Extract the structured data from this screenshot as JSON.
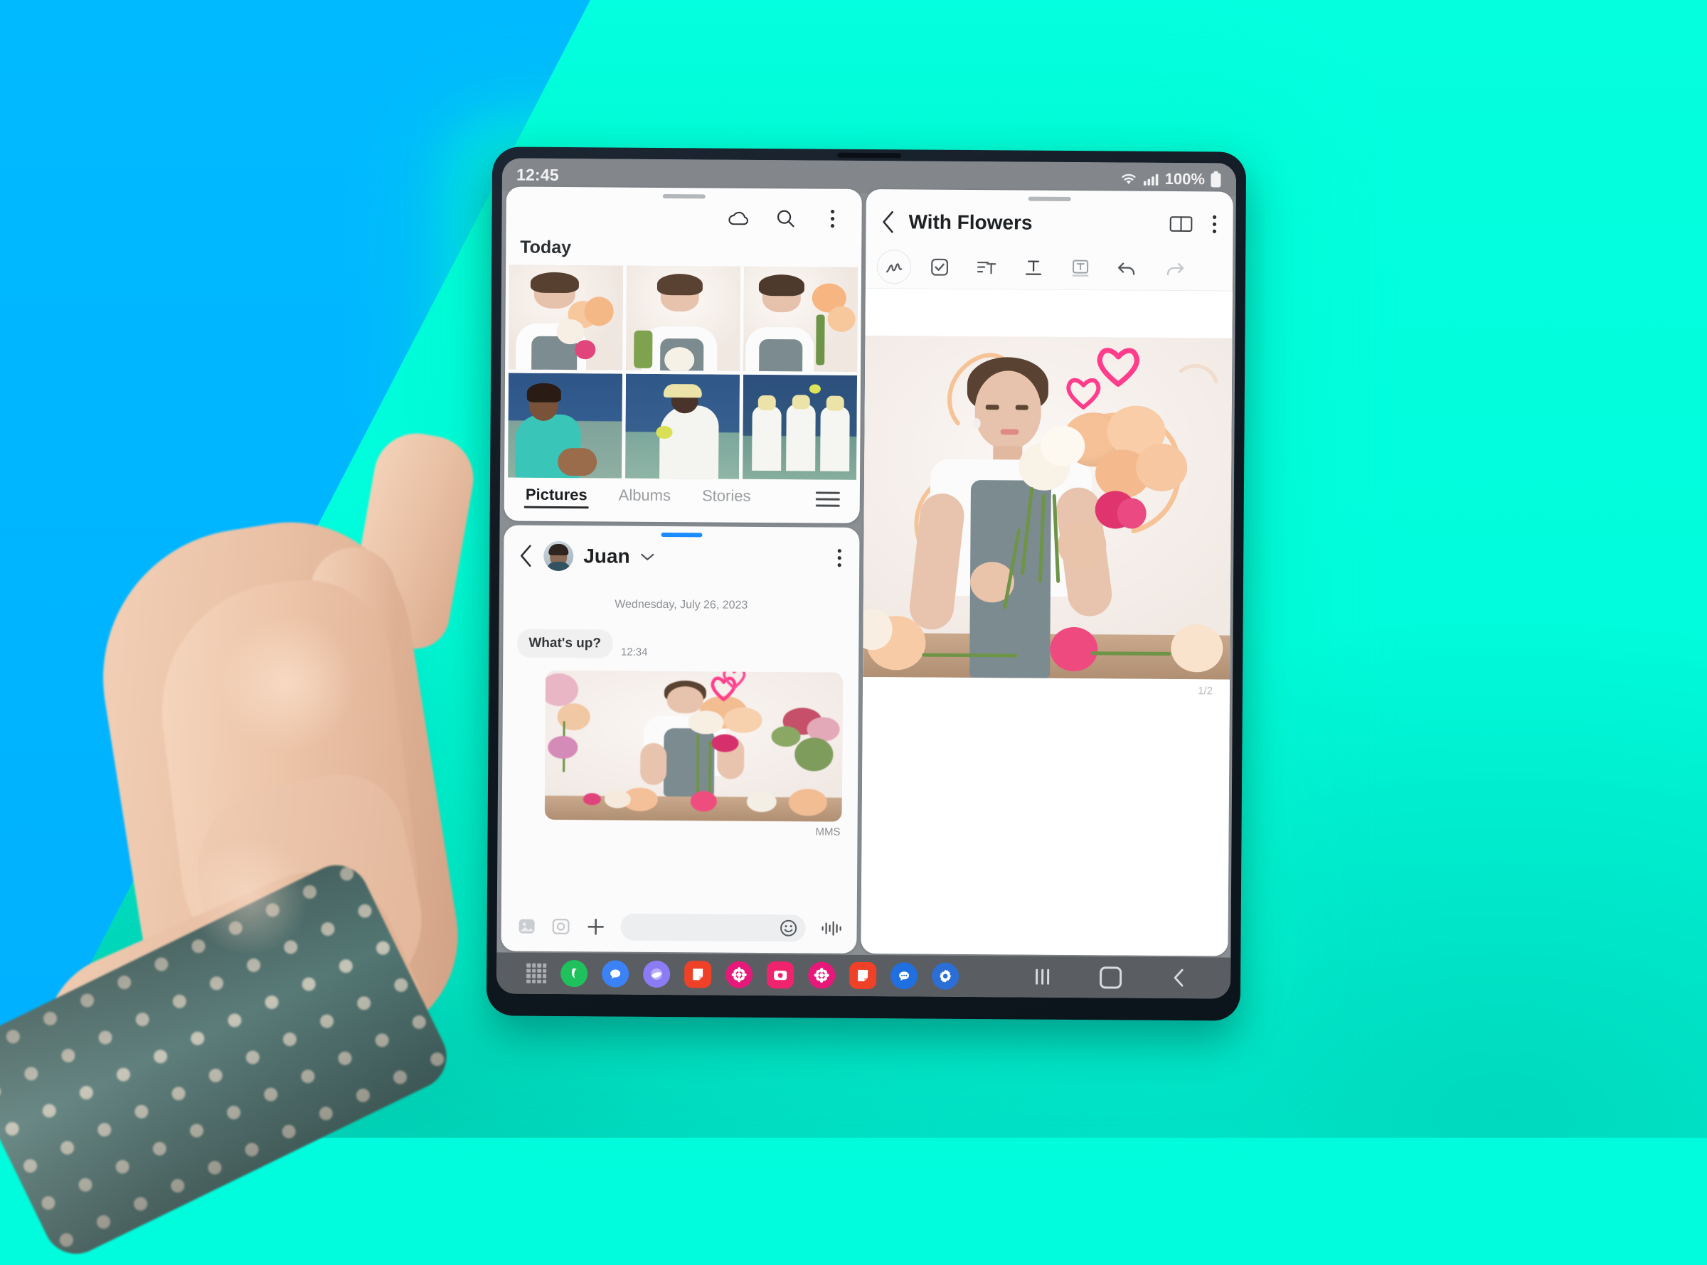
{
  "background": {
    "blue": "#00b4ff",
    "teal": "#00fcdc",
    "teal_shadow": "#00c9ae"
  },
  "device": {
    "name": "foldable-phone",
    "frame_color": "#101820"
  },
  "status_bar": {
    "clock": "12:45",
    "wifi_icon": "wifi-icon",
    "signal_icon": "cellular-signal-icon",
    "battery_percent": "100%",
    "battery_icon": "battery-full-icon"
  },
  "gallery": {
    "window_name": "gallery-app",
    "grabber": "window-handle",
    "actions": [
      {
        "name": "cloud-sync-icon",
        "label": "Cloud"
      },
      {
        "name": "search-icon",
        "label": "Search"
      },
      {
        "name": "more-options-icon",
        "label": "More options"
      }
    ],
    "section_title": "Today",
    "thumbnails": [
      {
        "alt": "florist-smelling-peach-roses",
        "kind": "florist"
      },
      {
        "alt": "florist-looking-down-white-rose",
        "kind": "florist2"
      },
      {
        "alt": "florist-holding-peach-bouquet",
        "kind": "florist3"
      },
      {
        "alt": "tennis-player-resting-teal-towel",
        "kind": "tennis1"
      },
      {
        "alt": "tennis-player-in-white-cap",
        "kind": "tennis2"
      },
      {
        "alt": "three-tennis-players-serving",
        "kind": "tennis3"
      }
    ],
    "tabs": [
      {
        "label": "Pictures",
        "active": true
      },
      {
        "label": "Albums",
        "active": false
      },
      {
        "label": "Stories",
        "active": false
      }
    ],
    "menu_icon": "hamburger-menu-icon"
  },
  "messages": {
    "window_name": "messages-app",
    "back_icon": "back-chevron-icon",
    "avatar": "contact-avatar",
    "contact_name": "Juan",
    "dropdown_icon": "chevron-down-icon",
    "more_icon": "more-options-icon",
    "date_divider": "Wednesday, July 26, 2023",
    "bubbles": [
      {
        "text": "What's up?",
        "time": "12:34",
        "incoming": true
      }
    ],
    "attachment": {
      "alt": "florist-arranging-bouquet-photo",
      "label": "MMS"
    },
    "composer": {
      "gallery_icon": "image-picker-icon",
      "sticker_icon": "sticker-icon",
      "plus_icon": "add-attachment-icon",
      "input_placeholder": "",
      "input_value": "",
      "emoji_icon": "emoji-icon",
      "voice_icon": "voice-recording-icon"
    }
  },
  "notes": {
    "window_name": "samsung-notes-app",
    "back_icon": "back-chevron-icon",
    "title": "With Flowers",
    "view_mode_icon": "book-view-icon",
    "more_icon": "more-options-icon",
    "toolbar": [
      {
        "name": "pen-tool-icon",
        "label": "Pen",
        "selected": true,
        "disabled": false
      },
      {
        "name": "checkbox-list-icon",
        "label": "Checklist",
        "selected": false,
        "disabled": false
      },
      {
        "name": "paragraph-style-icon",
        "label": "Paragraph style",
        "selected": false,
        "disabled": false
      },
      {
        "name": "text-format-icon",
        "label": "Text format",
        "selected": false,
        "disabled": false
      },
      {
        "name": "text-box-icon",
        "label": "Text box",
        "selected": false,
        "disabled": false
      },
      {
        "name": "undo-icon",
        "label": "Undo",
        "selected": false,
        "disabled": false
      },
      {
        "name": "redo-icon",
        "label": "Redo",
        "selected": false,
        "disabled": true
      }
    ],
    "canvas": {
      "alt": "florist-arranging-peach-roses-with-pink-heart-doodles",
      "doodles": [
        "pink-heart-large",
        "pink-heart-small",
        "peach-scribbles"
      ]
    },
    "page_indicator": "1/2"
  },
  "taskbar": {
    "apps_grid_icon": "all-apps-grid-icon",
    "apps": [
      {
        "name": "phone-app-icon",
        "color": "#1ec15b",
        "glyph": "✆"
      },
      {
        "name": "messages-app-icon",
        "color": "#3b82f6",
        "glyph": "●"
      },
      {
        "name": "internet-app-icon",
        "color": "#8b7cf6",
        "glyph": "◐"
      },
      {
        "name": "notes-app-icon",
        "color": "#ef4127",
        "glyph": "◤"
      },
      {
        "name": "gallery-app-icon",
        "color": "#e6197a",
        "glyph": "❀"
      },
      {
        "name": "camera-app-icon",
        "color": "#f0246e",
        "glyph": "▣"
      },
      {
        "name": "gallery-app-icon-2",
        "color": "#e6197a",
        "glyph": "❀"
      },
      {
        "name": "notes-app-icon-2",
        "color": "#ef4127",
        "glyph": "◤"
      },
      {
        "name": "messages-app-icon-2",
        "color": "#1f6fe0",
        "glyph": "●"
      },
      {
        "name": "settings-app-icon",
        "color": "#2b6fd6",
        "glyph": "⚙"
      }
    ],
    "nav": [
      {
        "name": "recents-button",
        "label": "Recents"
      },
      {
        "name": "home-button",
        "label": "Home"
      },
      {
        "name": "back-button",
        "label": "Back"
      }
    ]
  }
}
